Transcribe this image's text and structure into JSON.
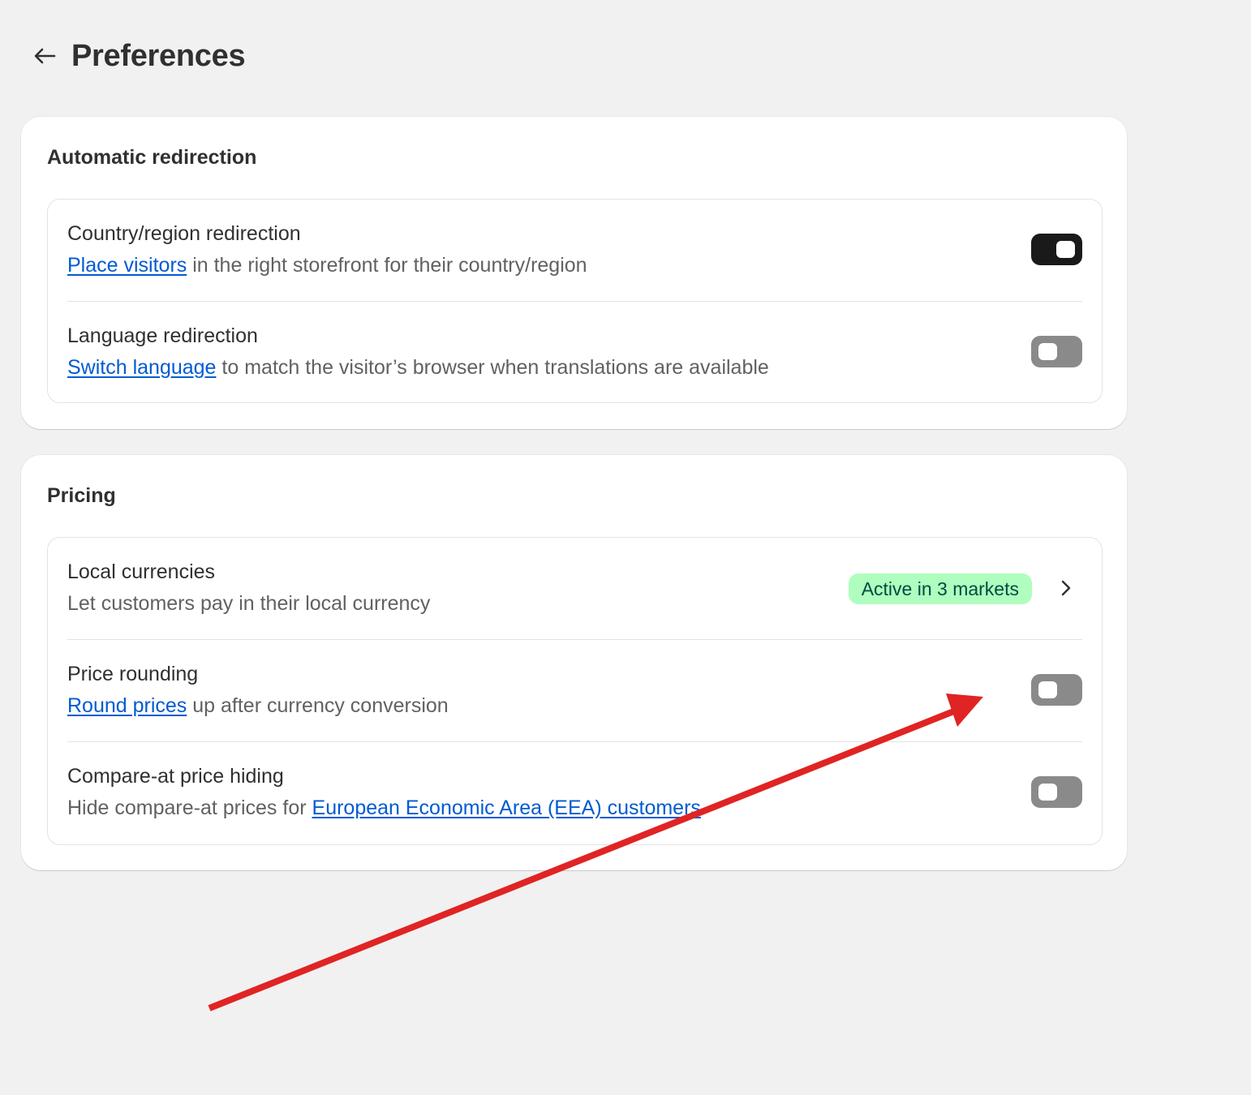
{
  "header": {
    "title": "Preferences"
  },
  "redirection": {
    "title": "Automatic redirection",
    "rows": [
      {
        "title": "Country/region redirection",
        "link": "Place visitors",
        "desc_rest": " in the right storefront for their country/region",
        "toggle": "on"
      },
      {
        "title": "Language redirection",
        "link": "Switch language",
        "desc_rest": " to match the visitor’s browser when translations are available",
        "toggle": "off"
      }
    ]
  },
  "pricing": {
    "title": "Pricing",
    "rows": [
      {
        "title": "Local currencies",
        "desc": "Let customers pay in their local currency",
        "badge": "Active in 3 markets"
      },
      {
        "title": "Price rounding",
        "link": "Round prices",
        "desc_rest": " up after currency conversion",
        "toggle": "off"
      },
      {
        "title": "Compare-at price hiding",
        "desc_pre": "Hide compare-at prices for ",
        "link": "European Economic Area (EEA) customers",
        "toggle": "off"
      }
    ]
  },
  "colors": {
    "background": "#f1f1f1",
    "link": "#005bd3",
    "toggle_on": "#1a1a1a",
    "toggle_off": "#8a8a8a",
    "badge_bg": "#affebf",
    "badge_text": "#014b40",
    "annotation_arrow": "#e02424"
  },
  "icons": {
    "back": "arrow-left-icon",
    "chevron": "chevron-right-icon",
    "annotation": "red-arrow-annotation"
  }
}
